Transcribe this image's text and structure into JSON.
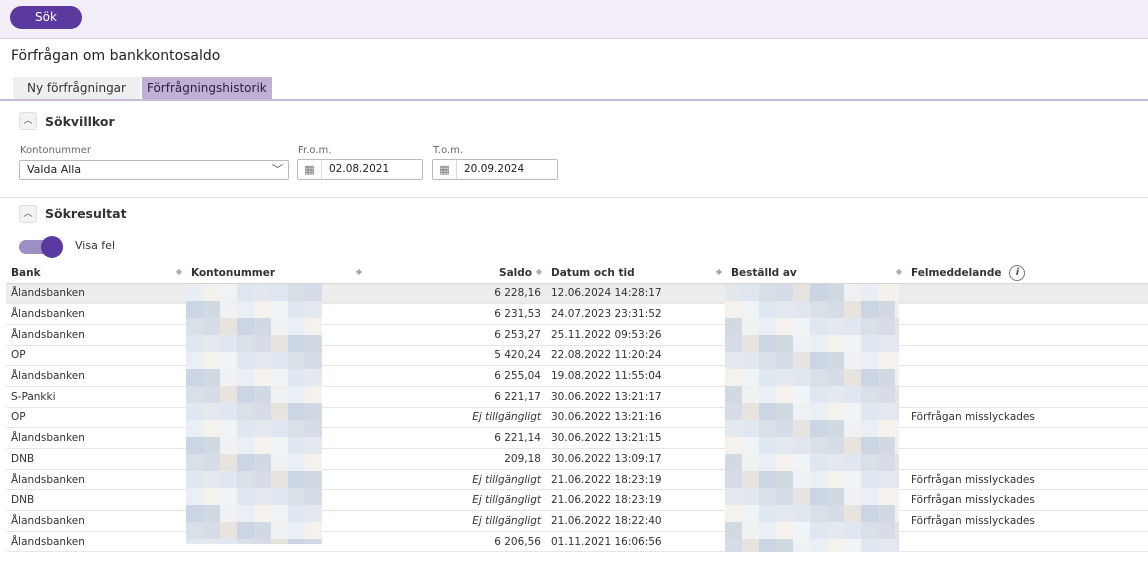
{
  "toolbar": {
    "search_label": "Sök"
  },
  "page_title": "Förfrågan om bankkontosaldo",
  "tabs": [
    {
      "label": "Ny förfrågningar",
      "active": false
    },
    {
      "label": "Förfrågningshistorik",
      "active": true
    }
  ],
  "criteria": {
    "section_title": "Sökvillkor",
    "toggle_icon": "chevron-up-icon",
    "account_label": "Kontonummer",
    "account_value": "Valda Alla",
    "from_label": "Fr.o.m.",
    "from_value": "02.08.2021",
    "to_label": "T.o.m.",
    "to_value": "20.09.2024"
  },
  "results": {
    "section_title": "Sökresultat",
    "show_errors_label": "Visa fel",
    "show_errors_on": true,
    "columns": [
      "Bank",
      "Kontonummer",
      "Saldo",
      "Datum och tid",
      "Beställd av",
      "Felmeddelande"
    ],
    "rows": [
      {
        "bank": "Ålandsbanken",
        "saldo": "6 228,16",
        "datetime": "12.06.2024 14:28:17",
        "error": ""
      },
      {
        "bank": "Ålandsbanken",
        "saldo": "6 231,53",
        "datetime": "24.07.2023 23:31:52",
        "error": ""
      },
      {
        "bank": "Ålandsbanken",
        "saldo": "6 253,27",
        "datetime": "25.11.2022 09:53:26",
        "error": ""
      },
      {
        "bank": "OP",
        "saldo": "5 420,24",
        "datetime": "22.08.2022 11:20:24",
        "error": ""
      },
      {
        "bank": "Ålandsbanken",
        "saldo": "6 255,04",
        "datetime": "19.08.2022 11:55:04",
        "error": ""
      },
      {
        "bank": "S-Pankki",
        "saldo": "6 221,17",
        "datetime": "30.06.2022 13:21:17",
        "error": ""
      },
      {
        "bank": "OP",
        "saldo": "Ej tillgängligt",
        "datetime": "30.06.2022 13:21:16",
        "error": "Förfrågan misslyckades"
      },
      {
        "bank": "Ålandsbanken",
        "saldo": "6 221,14",
        "datetime": "30.06.2022 13:21:15",
        "error": ""
      },
      {
        "bank": "DNB",
        "saldo": "209,18",
        "datetime": "30.06.2022 13:09:17",
        "error": ""
      },
      {
        "bank": "Ålandsbanken",
        "saldo": "Ej tillgängligt",
        "datetime": "21.06.2022 18:23:19",
        "error": "Förfrågan misslyckades"
      },
      {
        "bank": "DNB",
        "saldo": "Ej tillgängligt",
        "datetime": "21.06.2022 18:23:19",
        "error": "Förfrågan misslyckades"
      },
      {
        "bank": "Ålandsbanken",
        "saldo": "Ej tillgängligt",
        "datetime": "21.06.2022 18:22:40",
        "error": "Förfrågan misslyckades"
      },
      {
        "bank": "Ålandsbanken",
        "saldo": "6 206,56",
        "datetime": "01.11.2021 16:06:56",
        "error": ""
      }
    ]
  },
  "colors": {
    "accent": "#5a3a9e",
    "tab_active": "#bfb0d4",
    "topbar": "#f3eef8"
  }
}
